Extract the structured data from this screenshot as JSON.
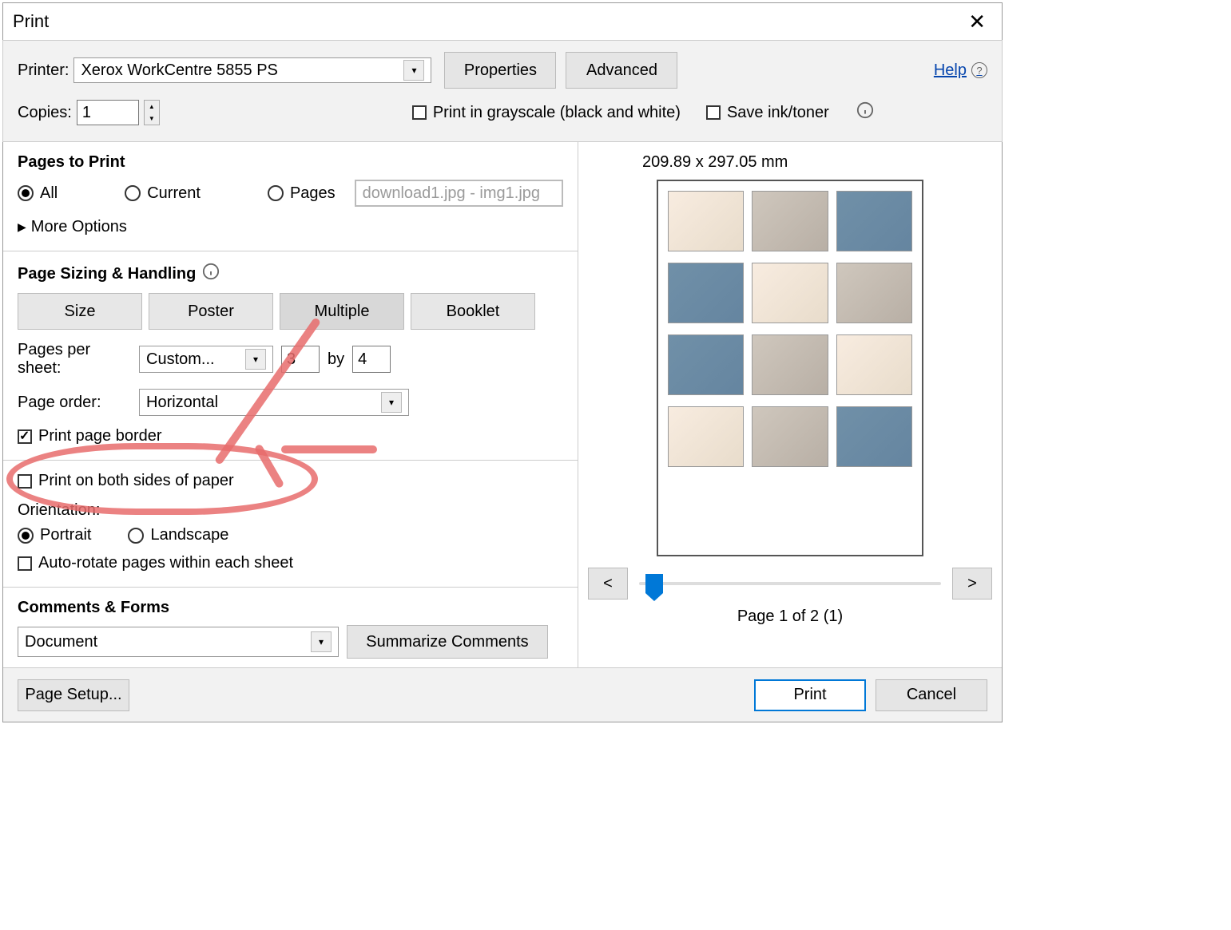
{
  "dialog": {
    "title": "Print"
  },
  "top": {
    "printer_label": "Printer:",
    "printer_value": "Xerox WorkCentre 5855 PS",
    "properties_btn": "Properties",
    "advanced_btn": "Advanced",
    "help_link": "Help",
    "copies_label": "Copies:",
    "copies_value": "1",
    "grayscale_label": "Print in grayscale (black and white)",
    "saveink_label": "Save ink/toner"
  },
  "pages": {
    "heading": "Pages to Print",
    "all": "All",
    "current": "Current",
    "pages": "Pages",
    "range_placeholder": "download1.jpg - img1.jpg",
    "more_options": "More Options"
  },
  "sizing": {
    "heading": "Page Sizing & Handling",
    "tab_size": "Size",
    "tab_poster": "Poster",
    "tab_multiple": "Multiple",
    "tab_booklet": "Booklet",
    "pps_label": "Pages per sheet:",
    "pps_value": "Custom...",
    "cols": "3",
    "by": "by",
    "rows": "4",
    "order_label": "Page order:",
    "order_value": "Horizontal",
    "border_label": "Print page border",
    "border_checked": true
  },
  "duplex": {
    "label": "Print on both sides of paper"
  },
  "orientation": {
    "heading": "Orientation:",
    "portrait": "Portrait",
    "landscape": "Landscape",
    "autorotate": "Auto-rotate pages within each sheet"
  },
  "comments": {
    "heading": "Comments & Forms",
    "value": "Document",
    "summarize_btn": "Summarize Comments"
  },
  "preview": {
    "dimensions": "209.89 x 297.05 mm",
    "prev": "<",
    "next": ">",
    "page_label": "Page 1 of 2 (1)"
  },
  "footer": {
    "page_setup": "Page Setup...",
    "print": "Print",
    "cancel": "Cancel"
  }
}
